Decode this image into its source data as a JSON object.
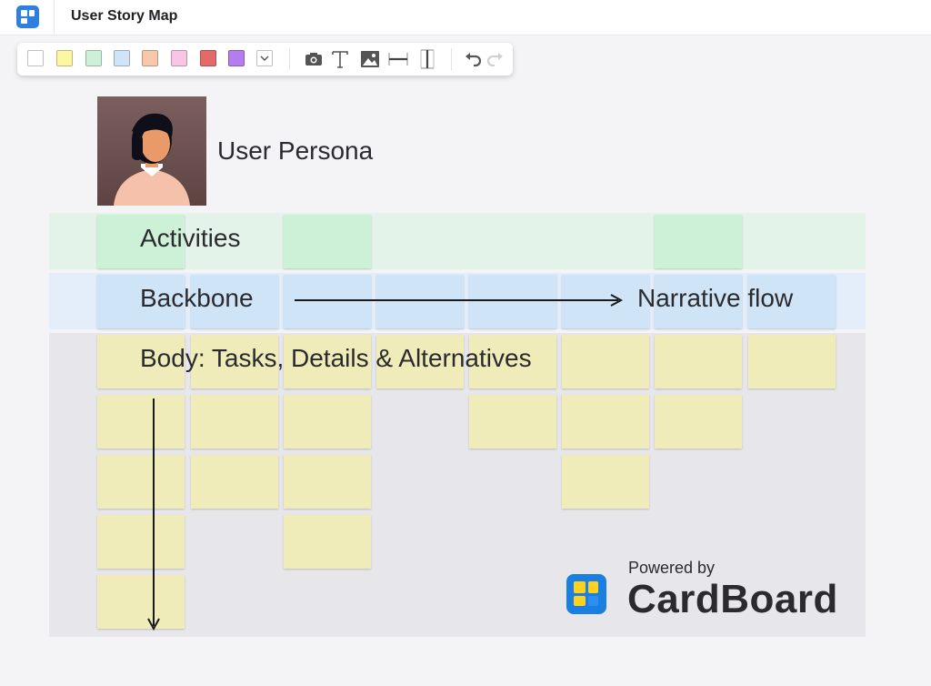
{
  "header": {
    "app_icon": "cardboard-app-icon",
    "title": "User Story Map"
  },
  "toolbar": {
    "swatches": [
      {
        "name": "white",
        "color": "#ffffff"
      },
      {
        "name": "yellow",
        "color": "#fdf6a3"
      },
      {
        "name": "green",
        "color": "#cdf1d6"
      },
      {
        "name": "blue",
        "color": "#cfe4f6"
      },
      {
        "name": "orange",
        "color": "#f8c8a8"
      },
      {
        "name": "pink",
        "color": "#f6c6e4"
      },
      {
        "name": "red",
        "color": "#e46a6a"
      },
      {
        "name": "purple",
        "color": "#b57cf0"
      }
    ],
    "tools": [
      "chevron-down-icon",
      "camera-icon",
      "text-icon",
      "image-icon",
      "horizontal-divider-icon",
      "vertical-divider-icon",
      "undo-icon",
      "redo-icon"
    ]
  },
  "board": {
    "persona_label": "User Persona",
    "activities_label": "Activities",
    "backbone_label": "Backbone",
    "narrative_label": "Narrative flow",
    "body_label": "Body: Tasks, Details & Alternatives",
    "colors": {
      "activities_band": "#e3f3ea",
      "backbone_band": "#e4eefb",
      "body_band": "#e7e7eb",
      "activity_card": "#cdf1d6",
      "backbone_card": "#cfe4f6",
      "task_card": "#f0ecb9"
    }
  },
  "branding": {
    "powered_by": "Powered by",
    "name": "CardBoard",
    "logo_color": "#1a7fe0"
  }
}
